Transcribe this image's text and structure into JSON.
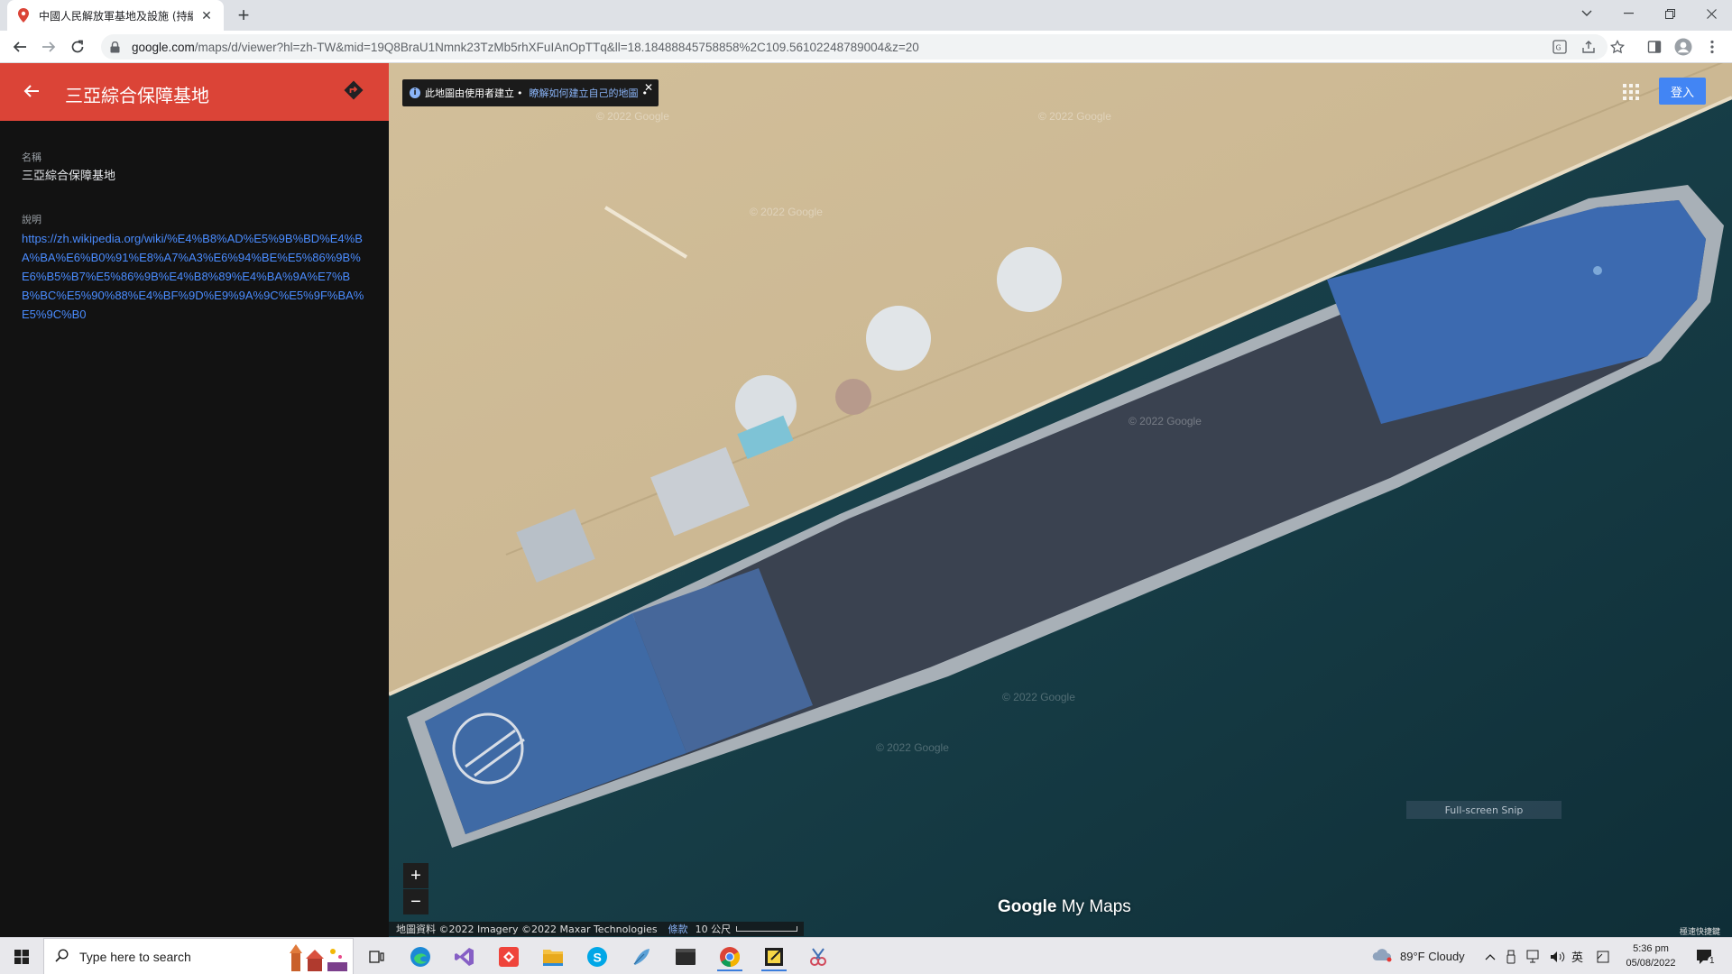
{
  "browser": {
    "tab_title": "中國人民解放軍基地及設施 (持續...",
    "url_host": "google.com",
    "url_path": "/maps/d/viewer?hl=zh-TW&mid=19Q8BraU1Nmnk23TzMb5rhXFuIAnOpTTq&ll=18.18488845758858%2C109.56102248789004&z=20"
  },
  "sidebar": {
    "title": "三亞綜合保障基地",
    "name_label": "名稱",
    "name_value": "三亞綜合保障基地",
    "desc_label": "說明",
    "desc_link": "https://zh.wikipedia.org/wiki/%E4%B8%AD%E5%9B%BD%E4%BA%BA%E6%B0%91%E8%A7%A3%E6%94%BE%E5%86%9B%E6%B5%B7%E5%86%9B%E4%B8%89%E4%BA%9A%E7%BB%BC%E5%90%88%E4%BF%9D%E9%9A%9C%E5%9F%BA%E5%9C%B0"
  },
  "map": {
    "info_text": "此地圖由使用者建立",
    "info_link": "瞭解如何建立自己的地圖",
    "signin": "登入",
    "zoom_in": "+",
    "zoom_out": "−",
    "brand_google": "Google",
    "brand_mymaps": "My Maps",
    "attribution": "地圖資料 ©2022 Imagery ©2022 Maxar Technologies",
    "terms": "條款",
    "scale": "10 公尺",
    "watermark": "© 2022 Google",
    "snip_label": "Full-screen Snip",
    "speed_label": "極速快捷鍵"
  },
  "taskbar": {
    "search_placeholder": "Type here to search",
    "weather": "89°F  Cloudy",
    "ime": "英",
    "time": "5:36 pm",
    "date": "05/08/2022",
    "notif_count": "1"
  },
  "colors": {
    "panel_header": "#db4437",
    "panel_bg": "#121212",
    "link": "#4a8cff",
    "signin": "#4285f4",
    "sand": "#cdb894",
    "sea": "#173f48"
  }
}
